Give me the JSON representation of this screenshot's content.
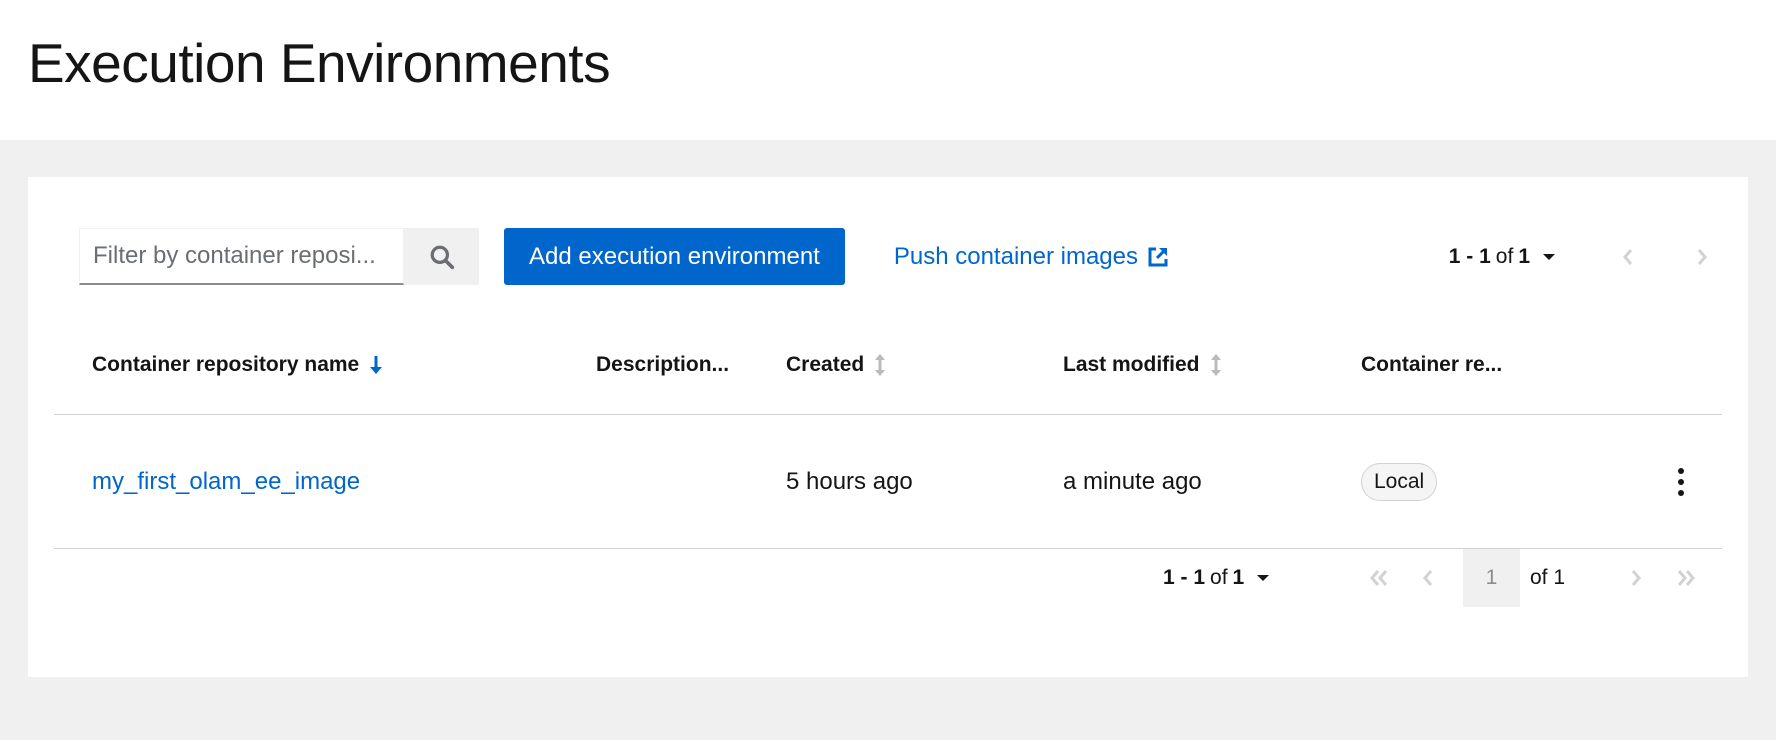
{
  "page": {
    "title": "Execution Environments"
  },
  "toolbar": {
    "search_placeholder": "Filter by container reposi...",
    "add_button": "Add execution environment",
    "push_link": "Push container images",
    "pagination": {
      "range": "1 - 1",
      "of_text": "of",
      "total": "1"
    }
  },
  "table": {
    "columns": [
      {
        "label": "Container repository name",
        "sort": "desc"
      },
      {
        "label": "Description..."
      },
      {
        "label": "Created",
        "sort": "none"
      },
      {
        "label": "Last modified",
        "sort": "none"
      },
      {
        "label": "Container re..."
      }
    ],
    "rows": [
      {
        "name": "my_first_olam_ee_image",
        "description": "",
        "created": "5 hours ago",
        "last_modified": "a minute ago",
        "registry": "Local"
      }
    ]
  },
  "bottom_pagination": {
    "range": "1 - 1",
    "of_text": "of",
    "total": "1",
    "current_page": "1",
    "of_pages": "of 1"
  },
  "colors": {
    "primary": "#0066cc",
    "background": "#f0f0f0",
    "border": "#d2d2d2",
    "disabled": "#d2d2d2"
  },
  "icons": [
    "search-icon",
    "external-link-icon",
    "caret-down-icon",
    "angle-left-icon",
    "angle-right-icon",
    "angle-double-left-icon",
    "angle-double-right-icon",
    "sort-down-icon",
    "sort-icon",
    "kebab-icon"
  ]
}
